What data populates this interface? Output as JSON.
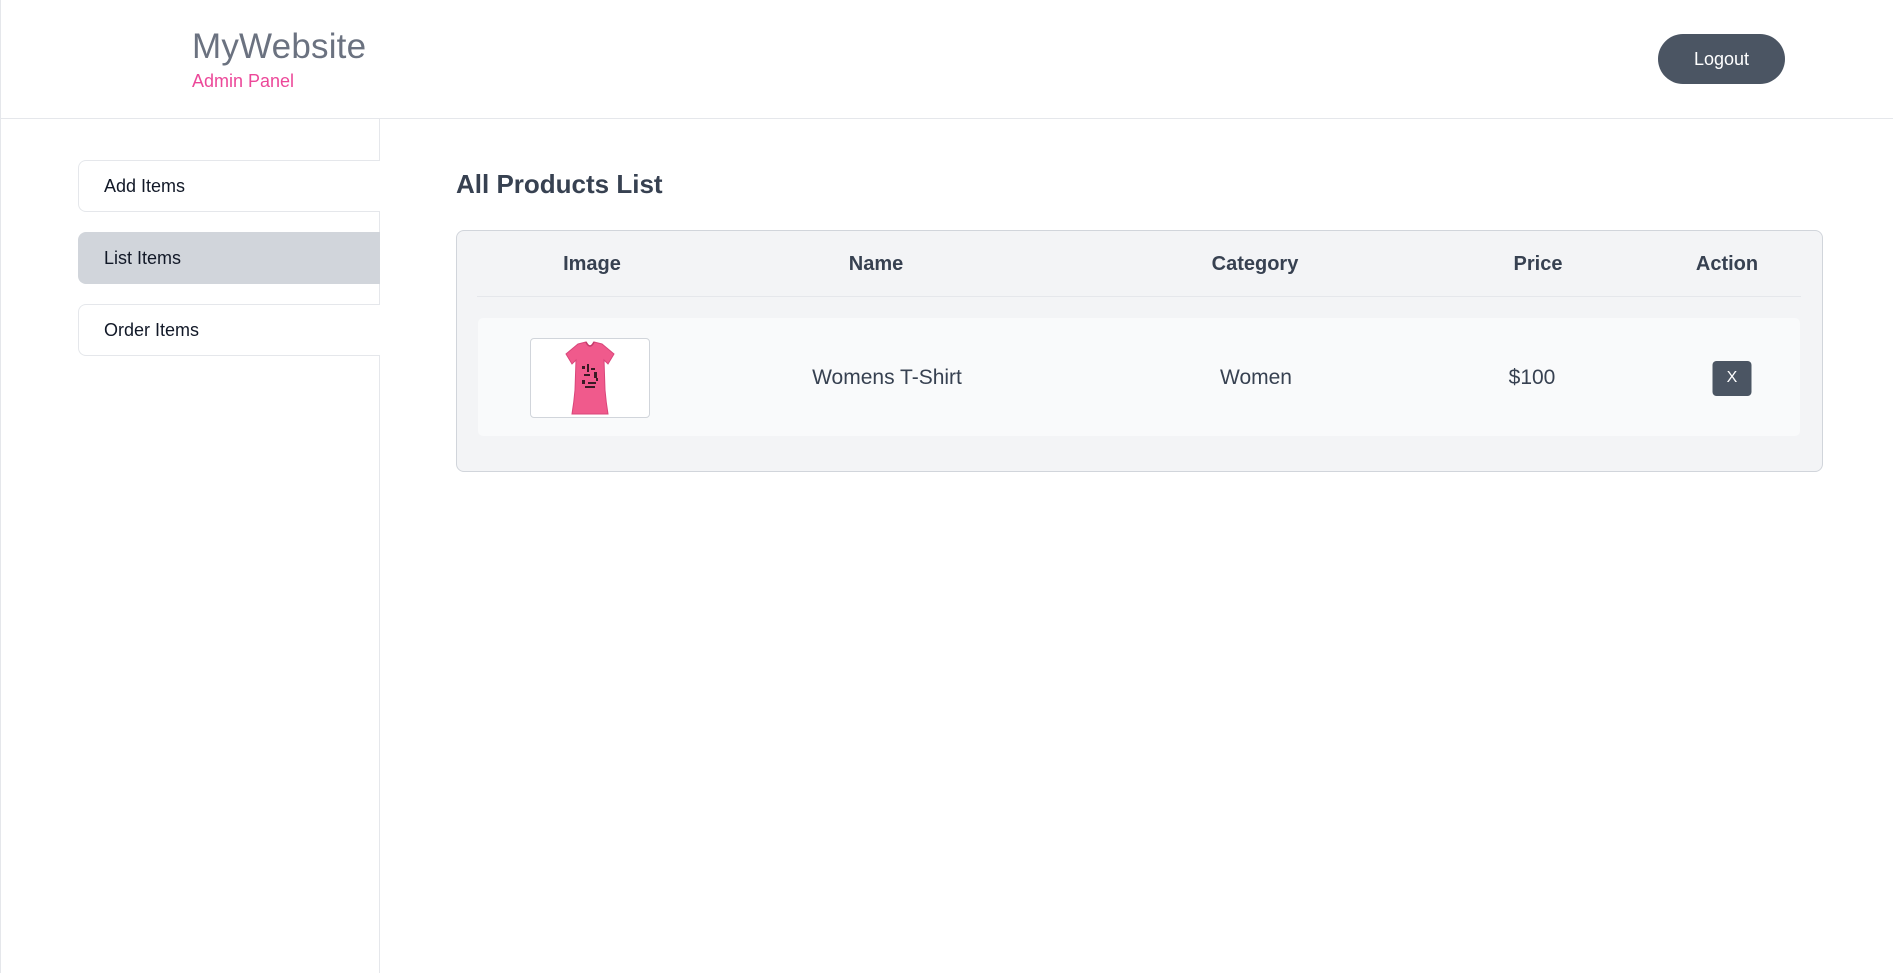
{
  "header": {
    "title": "MyWebsite",
    "subtitle": "Admin Panel",
    "logout_label": "Logout"
  },
  "sidebar": {
    "items": [
      {
        "label": "Add Items",
        "active": false
      },
      {
        "label": "List Items",
        "active": true
      },
      {
        "label": "Order Items",
        "active": false
      }
    ]
  },
  "main": {
    "title": "All Products List",
    "columns": [
      "Image",
      "Name",
      "Category",
      "Price",
      "Action"
    ],
    "rows": [
      {
        "image_icon": "pink-tshirt-image",
        "name": "Womens T-Shirt",
        "category": "Women",
        "price": "$100",
        "action": "X"
      }
    ]
  },
  "colors": {
    "accent": "#ec4899",
    "button": "#4b5563",
    "active_item": "#d1d5db",
    "card_bg": "#f3f4f6"
  }
}
